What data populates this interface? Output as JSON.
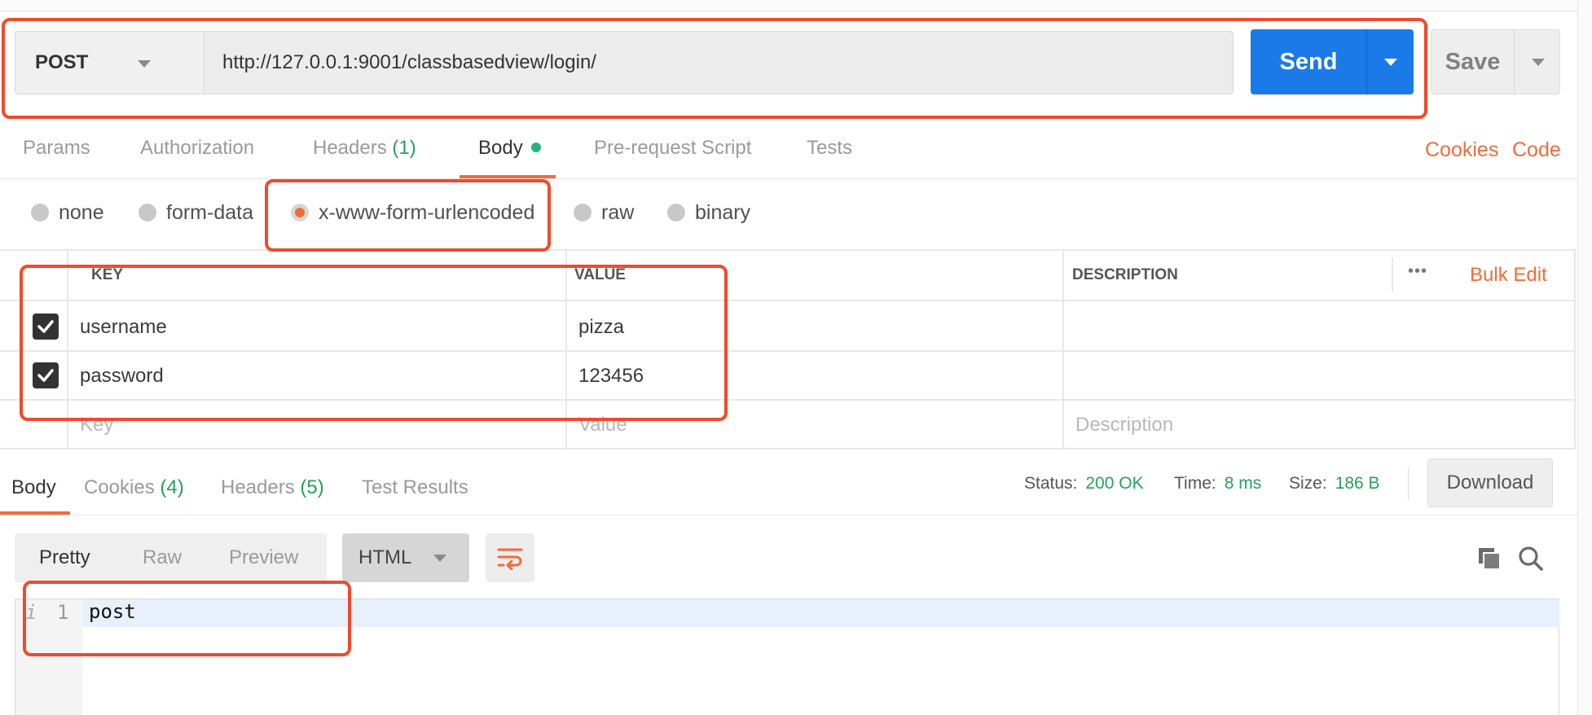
{
  "request": {
    "method": "POST",
    "url": "http://127.0.0.1:9001/classbasedview/login/",
    "send_label": "Send",
    "save_label": "Save"
  },
  "request_tabs": {
    "params": "Params",
    "authorization": "Authorization",
    "headers": "Headers",
    "headers_count": "(1)",
    "body": "Body",
    "pre_request": "Pre-request Script",
    "tests": "Tests",
    "cookies_link": "Cookies",
    "code_link": "Code"
  },
  "body_types": {
    "none": "none",
    "form_data": "form-data",
    "urlencoded": "x-www-form-urlencoded",
    "raw": "raw",
    "binary": "binary",
    "selected": "x-www-form-urlencoded"
  },
  "params_table": {
    "headers": {
      "key": "KEY",
      "value": "VALUE",
      "description": "DESCRIPTION"
    },
    "more_label": "•••",
    "bulk_edit": "Bulk Edit",
    "rows": [
      {
        "checked": true,
        "key": "username",
        "value": "pizza",
        "description": ""
      },
      {
        "checked": true,
        "key": "password",
        "value": "123456",
        "description": ""
      }
    ],
    "placeholders": {
      "key": "Key",
      "value": "Value",
      "description": "Description"
    }
  },
  "response": {
    "tabs": {
      "body": "Body",
      "cookies": "Cookies",
      "cookies_count": "(4)",
      "headers": "Headers",
      "headers_count": "(5)",
      "test_results": "Test Results"
    },
    "status_label": "Status:",
    "status_value": "200 OK",
    "time_label": "Time:",
    "time_value": "8 ms",
    "size_label": "Size:",
    "size_value": "186 B",
    "download_label": "Download",
    "view_modes": {
      "pretty": "Pretty",
      "raw": "Raw",
      "preview": "Preview"
    },
    "format": "HTML",
    "editor": {
      "line_info": "i",
      "line_number": "1",
      "content": "post"
    }
  },
  "colors": {
    "accent": "#f26b3a",
    "send_blue": "#1a7ae8",
    "success_green": "#26a05a",
    "annotation_red": "#f04a2c"
  },
  "icons": [
    "chevron-down-icon",
    "wrap-lines-icon",
    "copy-icon",
    "search-icon",
    "checkbox-checked-icon",
    "radio-icon",
    "more-options-icon"
  ]
}
